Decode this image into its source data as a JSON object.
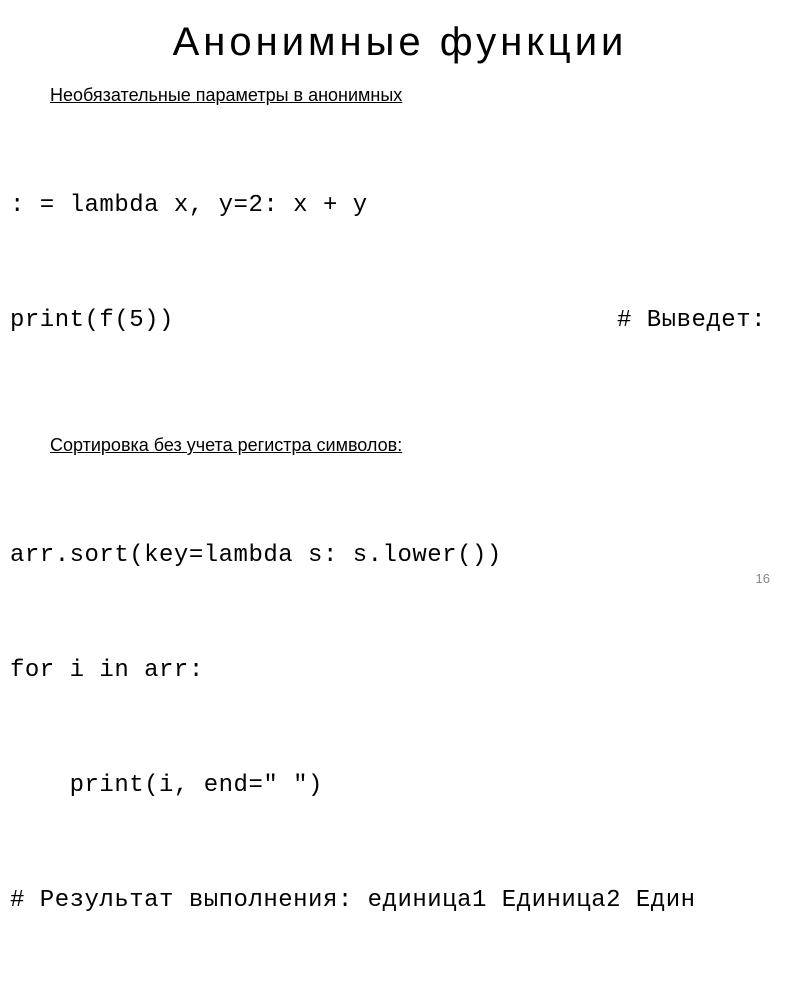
{
  "title": "Анонимные функции",
  "section1": {
    "label": "Необязательные параметры в анонимных",
    "line1_left": ": = lambda x, y=2: x + y",
    "line2_left": "print(f(5))",
    "line2_right": "# Выведет:"
  },
  "section2": {
    "label": "Сортировка без учета регистра символов:",
    "line1": "arr.sort(key=lambda s: s.lower())",
    "line2": "for i in arr:",
    "line3": "    print(i, end=\" \")",
    "line4": "# Результат выполнения: единица1 Единица2 Един"
  },
  "page_number": "16"
}
